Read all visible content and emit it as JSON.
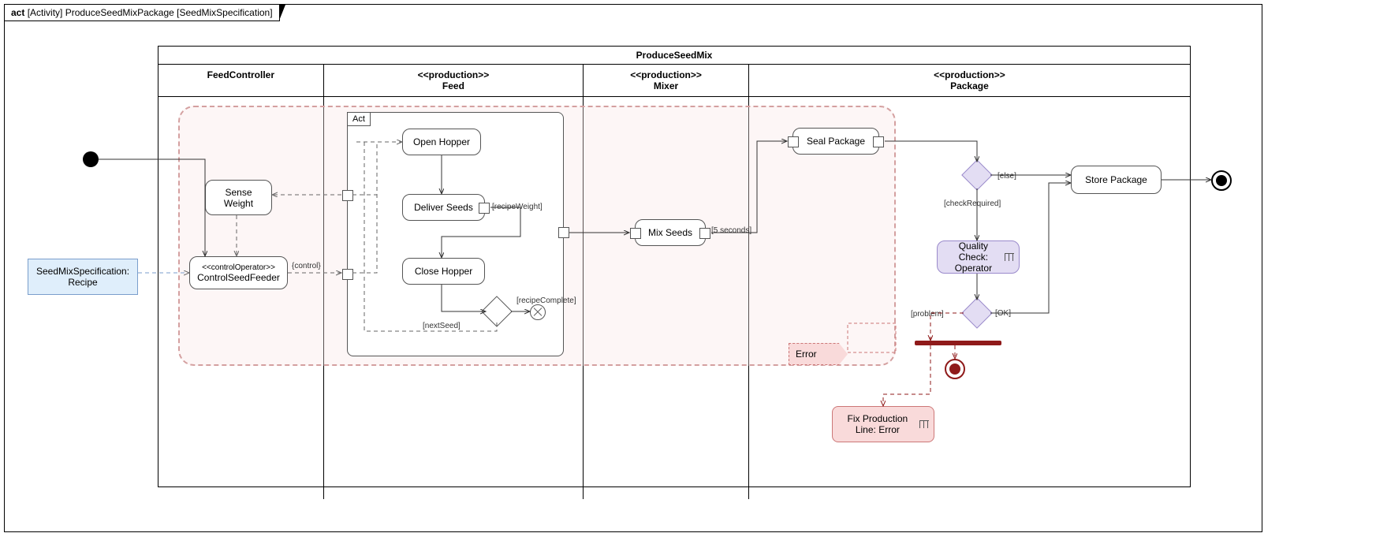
{
  "frame": {
    "kind": "act",
    "type": "[Activity]",
    "name": "ProduceSeedMixPackage",
    "param": "[SeedMixSpecification]"
  },
  "input": {
    "label": "SeedMixSpecification: Recipe"
  },
  "swimlane": {
    "title": "ProduceSeedMix",
    "lanes": [
      {
        "name": "FeedController"
      },
      {
        "stereo": "<<production>>",
        "name": "Feed"
      },
      {
        "stereo": "<<production>>",
        "name": "Mixer"
      },
      {
        "stereo": "<<production>>",
        "name": "Package"
      }
    ]
  },
  "actions": {
    "sense": "Sense Weight",
    "control": {
      "stereo": "<<controlOperator>>",
      "name": "ControlSeedFeeder"
    },
    "structLabel": "Act",
    "open": "Open Hopper",
    "deliver": "Deliver Seeds",
    "close": "Close Hopper",
    "mix": "Mix Seeds",
    "seal": "Seal Package",
    "store": "Store Package",
    "qc": "Quality Check: Operator",
    "error": "Error",
    "fix": "Fix Production Line: Error"
  },
  "guards": {
    "controlStream": "{control}",
    "recipeWeight": "[recipeWeight]",
    "nextSeed": "[nextSeed]",
    "recipeComplete": "[recipeComplete]",
    "fiveSec": "[5 seconds]",
    "else": "[else]",
    "checkRequired": "[checkRequired]",
    "ok": "[OK]",
    "problem": "[problem]"
  }
}
